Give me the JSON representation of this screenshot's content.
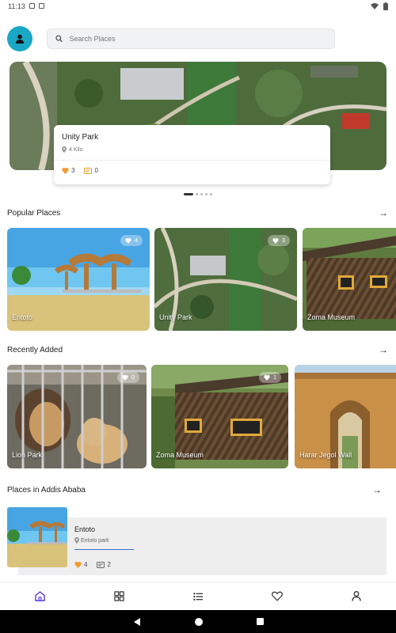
{
  "status": {
    "time": "11:13"
  },
  "search": {
    "placeholder": "Search Places"
  },
  "featured": {
    "title": "Unity Park",
    "distance": "4 Kilo",
    "likes": "3",
    "comments": "0"
  },
  "sections": {
    "popular": "Popular Places",
    "recent": "Recently Added",
    "city": "Places in Addis Ababa"
  },
  "popular": [
    {
      "name": "Entoto",
      "likes": "4"
    },
    {
      "name": "Unity Park",
      "likes": "3"
    },
    {
      "name": "Zoma Museum"
    }
  ],
  "recent": [
    {
      "name": "Lion Park",
      "likes": "0"
    },
    {
      "name": "Zoma Museum",
      "likes": "1"
    },
    {
      "name": "Harar Jegol Wall"
    }
  ],
  "city_places": [
    {
      "name": "Entoto",
      "location": "Entoto park",
      "likes": "4",
      "comments": "2"
    }
  ],
  "nav": {
    "items": [
      "home-icon",
      "grid-icon",
      "list-icon",
      "heart-icon",
      "profile-icon"
    ]
  },
  "colors": {
    "accent": "#1aa7c4",
    "active_nav": "#4b2bd6",
    "like": "#f29a2e"
  }
}
